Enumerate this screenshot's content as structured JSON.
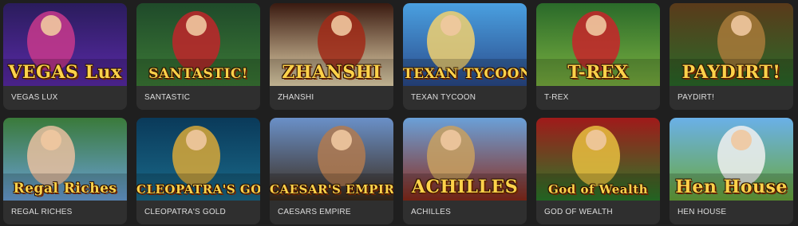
{
  "games": [
    {
      "title": "VEGAS LUX",
      "logo": "VEGAS Lux",
      "colors": [
        "#2a1c5c",
        "#c8388c",
        "#5a2aa8"
      ]
    },
    {
      "title": "SANTASTIC",
      "logo": "SANTASTIC!",
      "colors": [
        "#1f4a2a",
        "#c0262a",
        "#3c7a36"
      ]
    },
    {
      "title": "ZHANSHI",
      "logo": "ZHANSHI",
      "colors": [
        "#3a1a10",
        "#a02a18",
        "#e8d8b0"
      ]
    },
    {
      "title": "TEXAN TYCOON",
      "logo": "TEXAN TYCOON",
      "colors": [
        "#4aa0e0",
        "#f0d070",
        "#2a4a8a"
      ]
    },
    {
      "title": "T-REX",
      "logo": "T-REX",
      "colors": [
        "#2a6a2a",
        "#c8242a",
        "#7ab040"
      ]
    },
    {
      "title": "PAYDIRT!",
      "logo": "PAYDIRT!",
      "colors": [
        "#5a3a1a",
        "#a87a3a",
        "#2a6a2a"
      ]
    },
    {
      "title": "REGAL RICHES",
      "logo": "Regal Riches",
      "colors": [
        "#3a7a3a",
        "#e8c0a0",
        "#6aa0d8"
      ]
    },
    {
      "title": "CLEOPATRA'S GOLD",
      "logo": "CLEOPATRA'S GOLD",
      "colors": [
        "#0a3a5a",
        "#d8a838",
        "#1a6a8a"
      ]
    },
    {
      "title": "CAESARS EMPIRE",
      "logo": "CAESAR'S EMPIRE",
      "colors": [
        "#6a90c8",
        "#b07a50",
        "#3a2a1a"
      ]
    },
    {
      "title": "ACHILLES",
      "logo": "ACHILLES",
      "colors": [
        "#6aa0d8",
        "#c8a060",
        "#8a2a1a"
      ]
    },
    {
      "title": "GOD OF WEALTH",
      "logo": "God of Wealth",
      "colors": [
        "#a01a1a",
        "#e8c040",
        "#2a7a2a"
      ]
    },
    {
      "title": "HEN HOUSE",
      "logo": "Hen House",
      "colors": [
        "#6ab0e8",
        "#f0f0f0",
        "#6aa83a"
      ]
    }
  ]
}
